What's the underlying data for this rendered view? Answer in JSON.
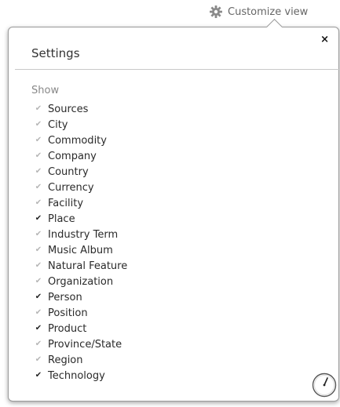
{
  "header": {
    "customize_label": "Customize view",
    "icon": "gear-icon"
  },
  "settings": {
    "title": "Settings",
    "close_label": "×",
    "section_label": "Show",
    "items": [
      {
        "label": "Sources",
        "checked": false
      },
      {
        "label": "City",
        "checked": false
      },
      {
        "label": "Commodity",
        "checked": false
      },
      {
        "label": "Company",
        "checked": false
      },
      {
        "label": "Country",
        "checked": false
      },
      {
        "label": "Currency",
        "checked": false
      },
      {
        "label": "Facility",
        "checked": false
      },
      {
        "label": "Place",
        "checked": true
      },
      {
        "label": "Industry Term",
        "checked": false
      },
      {
        "label": "Music Album",
        "checked": false
      },
      {
        "label": "Natural Feature",
        "checked": false
      },
      {
        "label": "Organization",
        "checked": false
      },
      {
        "label": "Person",
        "checked": true
      },
      {
        "label": "Position",
        "checked": false
      },
      {
        "label": "Product",
        "checked": true
      },
      {
        "label": "Province/State",
        "checked": false
      },
      {
        "label": "Region",
        "checked": false
      },
      {
        "label": "Technology",
        "checked": true
      }
    ]
  },
  "colors": {
    "checked": "#222222",
    "unchecked": "#b6b6b6",
    "text": "#2a2a2a",
    "muted": "#888888"
  }
}
